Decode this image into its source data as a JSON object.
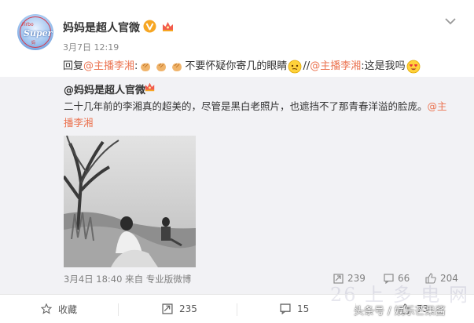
{
  "post": {
    "author": "妈妈是超人官微",
    "time": "3月7日 12:19",
    "reply_prefix": "回复",
    "mention1": "@主播李湘",
    "text_mid": "不要怀疑你寄几的眼睛",
    "repost_sep": "//",
    "mention2": "@主播李湘",
    "text_end": ":这是我吗",
    "colon": ":"
  },
  "quoted": {
    "author": "@妈妈是超人官微",
    "text": "二十几年前的李湘真的超美的，尽管是黑白老照片，也遮挡不了那青春洋溢的脸庞。",
    "mention": "@主播李湘",
    "meta": "3月4日 18:40 来自 专业版微博",
    "reposts": "239",
    "comments": "66",
    "likes": "204"
  },
  "actions": {
    "favorite": "收藏",
    "repost": "235",
    "comment": "15",
    "like": "73"
  },
  "avatar": {
    "line1": "Firbo",
    "line2": "Super",
    "line3": "妈"
  },
  "watermark": {
    "text": "头条号 / 娱乐芒果酱",
    "faint": "26 上 多 电 网"
  },
  "icons": {
    "verified": "verified-v-icon",
    "crown": "crown-icon",
    "chevron": "chevron-down-icon"
  },
  "colors": {
    "link": "#eb7350",
    "verified": "#f6a623",
    "quote_bg": "#f2f2f5",
    "meta": "#808080"
  }
}
